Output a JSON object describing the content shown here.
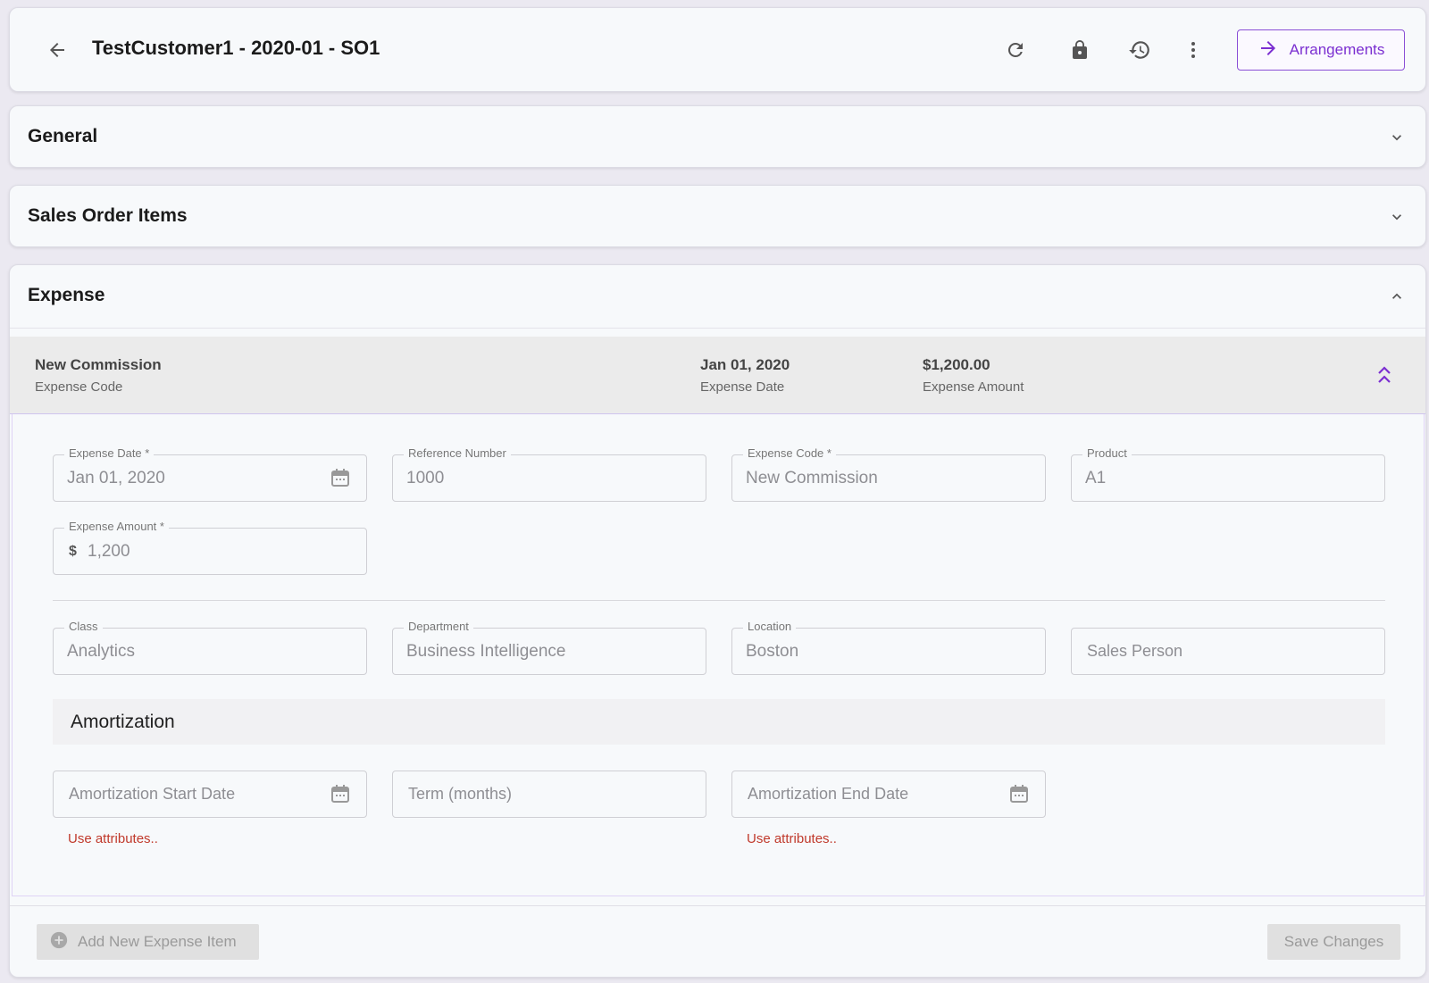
{
  "header": {
    "title": "TestCustomer1 - 2020-01 - SO1",
    "arrangements_label": "Arrangements"
  },
  "sections": {
    "general": "General",
    "sales_order_items": "Sales Order Items",
    "expense": "Expense"
  },
  "expense_item": {
    "code_value": "New Commission",
    "code_label": "Expense Code",
    "date_value": "Jan 01, 2020",
    "date_label": "Expense Date",
    "amount_value": "$1,200.00",
    "amount_label": "Expense Amount"
  },
  "form": {
    "expense_date": {
      "label": "Expense Date *",
      "value": "Jan 01, 2020"
    },
    "reference_number": {
      "label": "Reference Number",
      "value": "1000"
    },
    "expense_code": {
      "label": "Expense Code *",
      "value": "New Commission"
    },
    "product": {
      "label": "Product",
      "value": "A1"
    },
    "expense_amount": {
      "label": "Expense Amount *",
      "prefix": "$",
      "value": "1,200"
    },
    "class": {
      "label": "Class",
      "value": "Analytics"
    },
    "department": {
      "label": "Department",
      "value": "Business Intelligence"
    },
    "location": {
      "label": "Location",
      "value": "Boston"
    },
    "sales_person": {
      "placeholder": "Sales Person"
    }
  },
  "amortization": {
    "title": "Amortization",
    "start_date_placeholder": "Amortization Start Date",
    "term_placeholder": "Term (months)",
    "end_date_placeholder": "Amortization End Date",
    "start_date_hint": "Use attributes..",
    "end_date_hint": "Use attributes.."
  },
  "footer": {
    "add_item_label": "Add New Expense Item",
    "save_label": "Save Changes"
  },
  "colors": {
    "accent": "#7b2fd1",
    "error": "#c0392b",
    "disabled_bg": "#e0e0e0"
  }
}
